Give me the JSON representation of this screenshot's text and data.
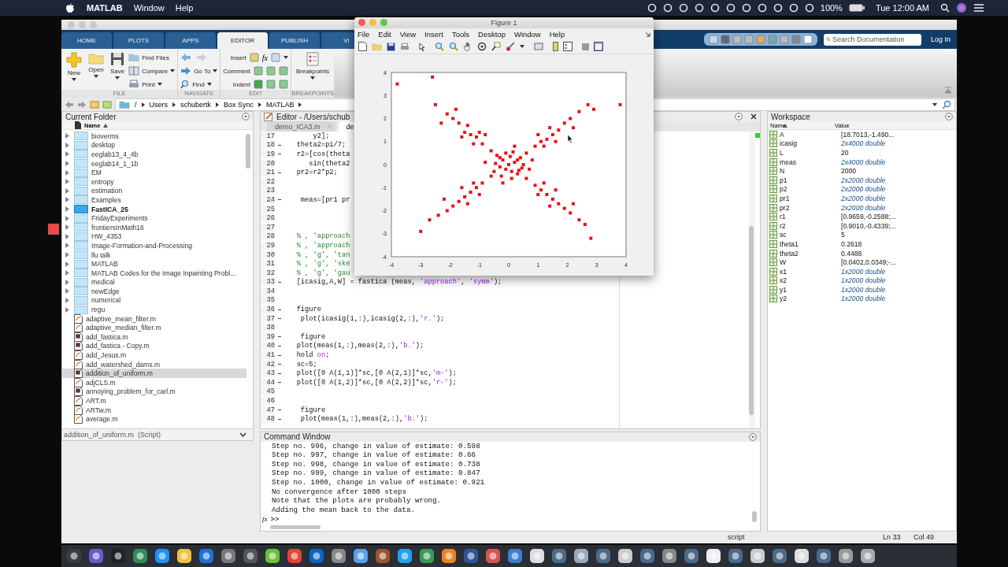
{
  "menubar": {
    "app": "MATLAB",
    "menus": [
      "Window",
      "Help"
    ],
    "battery": "100%",
    "clock": "Tue 12:00 AM"
  },
  "tabs": [
    {
      "label": "HOME",
      "selected": false
    },
    {
      "label": "PLOTS",
      "selected": false
    },
    {
      "label": "APPS",
      "selected": false
    },
    {
      "label": "EDITOR",
      "selected": true
    },
    {
      "label": "PUBLISH",
      "selected": false
    },
    {
      "label": "VI",
      "selected": false
    }
  ],
  "search": {
    "placeholder": "Search Documentation"
  },
  "login": "Log In",
  "toolstrip": {
    "file": {
      "new": "New",
      "open": "Open",
      "save": "Save",
      "find_files": "Find Files",
      "compare": "Compare",
      "print": "Print",
      "label": "FILE"
    },
    "navigate": {
      "go_to": "Go To",
      "find": "Find",
      "label": "NAVIGATE"
    },
    "edit": {
      "insert": "Insert",
      "fx": "fx",
      "comment": "Comment",
      "indent": "Indent",
      "label": "EDIT"
    },
    "breakpoints": {
      "breakpoints": "Breakpoints",
      "label": "BREAKPOINTS"
    }
  },
  "address": [
    "/",
    "Users",
    "schubertk",
    "Box Sync",
    "MATLAB"
  ],
  "current_folder": {
    "title": "Current Folder",
    "column": "Name",
    "items": [
      {
        "name": "bioverms",
        "kind": "folder",
        "selected": false,
        "highlighted": false
      },
      {
        "name": "desktop",
        "kind": "folder",
        "selected": false,
        "highlighted": false
      },
      {
        "name": "eeglab13_4_4b",
        "kind": "folder",
        "selected": false,
        "highlighted": false
      },
      {
        "name": "eeglab14_1_1b",
        "kind": "folder",
        "selected": false,
        "highlighted": false
      },
      {
        "name": "EM",
        "kind": "folder",
        "selected": false,
        "highlighted": false
      },
      {
        "name": "entropy",
        "kind": "folder",
        "selected": false,
        "highlighted": false
      },
      {
        "name": "estimation",
        "kind": "folder",
        "selected": false,
        "highlighted": false
      },
      {
        "name": "Examples",
        "kind": "folder",
        "selected": false,
        "highlighted": false
      },
      {
        "name": "FastICA_25",
        "kind": "folder",
        "selected": false,
        "highlighted": true
      },
      {
        "name": "FridayExperiments",
        "kind": "folder",
        "selected": false,
        "highlighted": false
      },
      {
        "name": "frontiersInMath16",
        "kind": "folder",
        "selected": false,
        "highlighted": false
      },
      {
        "name": "HW_4353",
        "kind": "folder",
        "selected": false,
        "highlighted": false
      },
      {
        "name": "Image-Formation-and-Processing",
        "kind": "folder",
        "selected": false,
        "highlighted": false
      },
      {
        "name": "llu talk",
        "kind": "folder",
        "selected": false,
        "highlighted": false
      },
      {
        "name": "MATLAB",
        "kind": "folder",
        "selected": false,
        "highlighted": false
      },
      {
        "name": "MATLAB Codes for the Image Inpainting Probl...",
        "kind": "folder",
        "selected": false,
        "highlighted": false
      },
      {
        "name": "medical",
        "kind": "folder",
        "selected": false,
        "highlighted": false
      },
      {
        "name": "newEdge",
        "kind": "folder",
        "selected": false,
        "highlighted": false
      },
      {
        "name": "numerical",
        "kind": "folder",
        "selected": false,
        "highlighted": false
      },
      {
        "name": "regu",
        "kind": "folder",
        "selected": false,
        "highlighted": false
      },
      {
        "name": "adaptive_mean_filter.m",
        "kind": "function",
        "selected": false,
        "highlighted": false
      },
      {
        "name": "adaptive_median_filter.m",
        "kind": "function",
        "selected": false,
        "highlighted": false
      },
      {
        "name": "add_fastica.m",
        "kind": "script",
        "selected": false,
        "highlighted": false
      },
      {
        "name": "add_fastica - Copy.m",
        "kind": "script",
        "selected": false,
        "highlighted": false
      },
      {
        "name": "add_Jesus.m",
        "kind": "function",
        "selected": false,
        "highlighted": false
      },
      {
        "name": "add_watershed_dams.m",
        "kind": "function",
        "selected": false,
        "highlighted": false
      },
      {
        "name": "addition_of_uniform.m",
        "kind": "script",
        "selected": true,
        "highlighted": false
      },
      {
        "name": "adjCLS.m",
        "kind": "function",
        "selected": false,
        "highlighted": false
      },
      {
        "name": "annoying_problem_for_carl.m",
        "kind": "script",
        "selected": false,
        "highlighted": false
      },
      {
        "name": "ART.m",
        "kind": "function",
        "selected": false,
        "highlighted": false
      },
      {
        "name": "ARTw.m",
        "kind": "function",
        "selected": false,
        "highlighted": false
      },
      {
        "name": "average.m",
        "kind": "function",
        "selected": false,
        "highlighted": false
      }
    ],
    "details": "addition_of_uniform.m  (Script)"
  },
  "editor": {
    "title": "Editor - /Users/schub",
    "tabs": [
      {
        "label": "demo_ICA3.m",
        "selected": false
      },
      {
        "label": "de",
        "selected": true
      }
    ],
    "lines": [
      {
        "n": "17",
        "dash": false,
        "parts": [
          {
            "kind": "code",
            "text": "       y2];"
          }
        ]
      },
      {
        "n": "18",
        "dash": true,
        "parts": [
          {
            "kind": "code",
            "text": "   theta2=pi/7;"
          }
        ]
      },
      {
        "n": "19",
        "dash": true,
        "parts": [
          {
            "kind": "code",
            "text": "   r2=[cos(theta"
          }
        ]
      },
      {
        "n": "20",
        "dash": false,
        "parts": [
          {
            "kind": "code",
            "text": "      sin(theta2"
          }
        ]
      },
      {
        "n": "21",
        "dash": true,
        "parts": [
          {
            "kind": "code",
            "text": "   pr2=r2*p2;"
          }
        ]
      },
      {
        "n": "22",
        "dash": false
      },
      {
        "n": "23",
        "dash": false
      },
      {
        "n": "24",
        "dash": true,
        "parts": [
          {
            "kind": "code",
            "text": "    meas=[pr1 pr"
          }
        ]
      },
      {
        "n": "25",
        "dash": false
      },
      {
        "n": "26",
        "dash": false
      },
      {
        "n": "27",
        "dash": false
      },
      {
        "n": "28",
        "dash": false,
        "parts": [
          {
            "kind": "comment",
            "text": "   % , 'approach"
          }
        ]
      },
      {
        "n": "29",
        "dash": false,
        "parts": [
          {
            "kind": "comment",
            "text": "   % , 'approach"
          }
        ]
      },
      {
        "n": "30",
        "dash": false,
        "parts": [
          {
            "kind": "comment",
            "text": "   % , 'g', 'tan"
          }
        ]
      },
      {
        "n": "31",
        "dash": false,
        "parts": [
          {
            "kind": "comment",
            "text": "   % , 'g', 'ske"
          }
        ]
      },
      {
        "n": "32",
        "dash": false,
        "parts": [
          {
            "kind": "comment",
            "text": "   % , 'g', 'gau"
          }
        ]
      },
      {
        "n": "33",
        "dash": true,
        "parts": [
          {
            "kind": "code",
            "text": "   [icasig,A,W] = fastica (meas, "
          },
          {
            "kind": "string",
            "text": "'approach'"
          },
          {
            "kind": "code",
            "text": ", "
          },
          {
            "kind": "string",
            "text": "'symm'"
          },
          {
            "kind": "code",
            "text": ");"
          }
        ]
      },
      {
        "n": "34",
        "dash": false
      },
      {
        "n": "35",
        "dash": false
      },
      {
        "n": "36",
        "dash": true,
        "parts": [
          {
            "kind": "code",
            "text": "   figure"
          }
        ]
      },
      {
        "n": "37",
        "dash": true,
        "parts": [
          {
            "kind": "code",
            "text": "    plot(icasig(1,:),icasig(2,:),"
          },
          {
            "kind": "string",
            "text": "'r.'"
          },
          {
            "kind": "code",
            "text": ");"
          }
        ]
      },
      {
        "n": "38",
        "dash": false
      },
      {
        "n": "39",
        "dash": true,
        "parts": [
          {
            "kind": "code",
            "text": "    figure"
          }
        ]
      },
      {
        "n": "40",
        "dash": true,
        "parts": [
          {
            "kind": "code",
            "text": "   plot(meas(1,:),meas(2,:),"
          },
          {
            "kind": "string",
            "text": "'b.'"
          },
          {
            "kind": "code",
            "text": ");"
          }
        ]
      },
      {
        "n": "41",
        "dash": true,
        "parts": [
          {
            "kind": "code",
            "text": "   hold "
          },
          {
            "kind": "string",
            "text": "on"
          },
          {
            "kind": "code",
            "text": ";"
          }
        ]
      },
      {
        "n": "42",
        "dash": true,
        "parts": [
          {
            "kind": "code",
            "text": "   sc=5;"
          }
        ]
      },
      {
        "n": "43",
        "dash": true,
        "parts": [
          {
            "kind": "code",
            "text": "   plot([0 A(1,1)]*sc,[0 A(2,1)]*sc,"
          },
          {
            "kind": "string",
            "text": "'m-'"
          },
          {
            "kind": "code",
            "text": ");"
          }
        ]
      },
      {
        "n": "44",
        "dash": true,
        "parts": [
          {
            "kind": "code",
            "text": "   plot([0 A(1,2)]*sc,[0 A(2,2)]*sc,"
          },
          {
            "kind": "string",
            "text": "'r-'"
          },
          {
            "kind": "code",
            "text": ");"
          }
        ]
      },
      {
        "n": "45",
        "dash": false
      },
      {
        "n": "46",
        "dash": false
      },
      {
        "n": "47",
        "dash": true,
        "parts": [
          {
            "kind": "code",
            "text": "    figure"
          }
        ]
      },
      {
        "n": "48",
        "dash": true,
        "parts": [
          {
            "kind": "code",
            "text": "    plot(meas(1,:),meas(2,:),"
          },
          {
            "kind": "string",
            "text": "'b.'"
          },
          {
            "kind": "code",
            "text": ");"
          }
        ]
      }
    ]
  },
  "command_window": {
    "title": "Command Window",
    "lines": [
      "Step no. 996, change in value of estimate: 0.598",
      "Step no. 997, change in value of estimate: 0.66",
      "Step no. 998, change in value of estimate: 0.738",
      "Step no. 999, change in value of estimate: 0.847",
      "Step no. 1000, change in value of estimate: 0.921",
      "No convergence after 1000 steps",
      "Note that the plots are probably wrong.",
      "Adding the mean back to the data."
    ],
    "fx": "fx",
    "prompt": ">>"
  },
  "workspace": {
    "title": "Workspace",
    "columns": [
      "Name",
      "Value"
    ],
    "rows": [
      {
        "name": "A",
        "value": "[18.7013,-1.490...",
        "kind": "value"
      },
      {
        "name": "icasig",
        "value": "2x4000 double",
        "kind": "summary"
      },
      {
        "name": "L",
        "value": "20",
        "kind": "value"
      },
      {
        "name": "meas",
        "value": "2x4000 double",
        "kind": "summary"
      },
      {
        "name": "N",
        "value": "2000",
        "kind": "value"
      },
      {
        "name": "p1",
        "value": "2x2000 double",
        "kind": "summary"
      },
      {
        "name": "p2",
        "value": "2x2000 double",
        "kind": "summary"
      },
      {
        "name": "pr1",
        "value": "2x2000 double",
        "kind": "summary"
      },
      {
        "name": "pr2",
        "value": "2x2000 double",
        "kind": "summary"
      },
      {
        "name": "r1",
        "value": "[0.9659,-0.2588;...",
        "kind": "value"
      },
      {
        "name": "r2",
        "value": "[0.9010,-0.4339;...",
        "kind": "value"
      },
      {
        "name": "sc",
        "value": "5",
        "kind": "value"
      },
      {
        "name": "theta1",
        "value": "0.2618",
        "kind": "value"
      },
      {
        "name": "theta2",
        "value": "0.4488",
        "kind": "value"
      },
      {
        "name": "W",
        "value": "[0.0402,0.0349;-...",
        "kind": "value"
      },
      {
        "name": "x1",
        "value": "1x2000 double",
        "kind": "summary"
      },
      {
        "name": "x2",
        "value": "1x2000 double",
        "kind": "summary"
      },
      {
        "name": "y1",
        "value": "1x2000 double",
        "kind": "summary"
      },
      {
        "name": "y2",
        "value": "1x2000 double",
        "kind": "summary"
      }
    ]
  },
  "status_bar": {
    "mode": "script",
    "line": "Ln 33",
    "col": "Col 49"
  },
  "figure": {
    "title": "Figure 1",
    "menus": [
      "File",
      "Edit",
      "View",
      "Insert",
      "Tools",
      "Desktop",
      "Window",
      "Help"
    ],
    "chart_data": {
      "type": "scatter",
      "xlim": [
        -4,
        4
      ],
      "ylim": [
        -4,
        4
      ],
      "xticks": [
        -4,
        -3,
        -2,
        -1,
        0,
        1,
        2,
        3,
        4
      ],
      "yticks": [
        -4,
        -3,
        -2,
        -1,
        0,
        1,
        2,
        3,
        4
      ],
      "x": [
        0,
        0.2,
        -0.2,
        0.1,
        -0.3,
        0.4,
        -0.4,
        0.3,
        -0.5,
        0.5,
        -0.1,
        0.1,
        0.6,
        -0.6,
        0.6,
        -0.6,
        0.8,
        -0.8,
        0.2,
        -0.2,
        0.3,
        -0.3,
        0.7,
        -0.1,
        0.05,
        -0.45,
        0.45,
        0.15,
        -0.25,
        0.35,
        -0.9,
        -1.1,
        -1.3,
        -1.5,
        -1.2,
        -1.7,
        -1.9,
        -2.1,
        -1,
        -1.6,
        -2.3,
        -0.8,
        -1.4,
        -2.5,
        -1.8,
        0.9,
        1.1,
        1.3,
        1.5,
        1.2,
        1.7,
        1.9,
        2.1,
        2.4,
        1,
        1.6,
        2.2,
        2.7,
        1.4,
        2.9,
        -0.9,
        -1.1,
        -1.3,
        -1.5,
        -1.2,
        -1.7,
        -1.9,
        -2.1,
        -2.4,
        -1,
        -1.6,
        -2.2,
        -2.7,
        -3,
        -1.4,
        0.9,
        1.1,
        1.3,
        1.5,
        1.2,
        1.7,
        1.9,
        2.1,
        2.4,
        1,
        1.6,
        2.2,
        2.6,
        2.8,
        1.4,
        -3.8,
        -2.6,
        3.8
      ],
      "series": [
        {
          "color": "#e8101a",
          "values": [
            0,
            0.1,
            0.2,
            -0.3,
            -0.1,
            0.3,
            0.4,
            -0.4,
            -0.3,
            0,
            0.5,
            -0.6,
            0.5,
            0.6,
            -0.6,
            -0.5,
            0.2,
            0.1,
            0.8,
            -0.8,
            0.2,
            0.3,
            -0.2,
            -0.2,
            0.35,
            0.05,
            -0.15,
            0.55,
            -0.5,
            -0.25,
            0.9,
            1.2,
            1.3,
            1.4,
            0.9,
            1.8,
            2,
            2.2,
            1.4,
            1.2,
            1.8,
            1.3,
            1.7,
            2.6,
            2.4,
            0.8,
            1,
            1.1,
            1.3,
            0.8,
            1.5,
            1.8,
            2,
            2.3,
            1.3,
            1,
            1.6,
            2.6,
            1.6,
            2.4,
            -0.8,
            -1,
            -1.2,
            -1.4,
            -0.8,
            -1.6,
            -1.8,
            -2,
            -2.2,
            -1.3,
            -1,
            -1.5,
            -2.4,
            -2.9,
            -1.7,
            -0.9,
            -1.1,
            -1.3,
            -1.5,
            -0.8,
            -1.7,
            -1.9,
            -2.1,
            -2.4,
            -1.3,
            -1.1,
            -1.7,
            -2.6,
            -3.2,
            -1.8,
            3.5,
            3.8,
            2.6
          ]
        }
      ]
    }
  }
}
